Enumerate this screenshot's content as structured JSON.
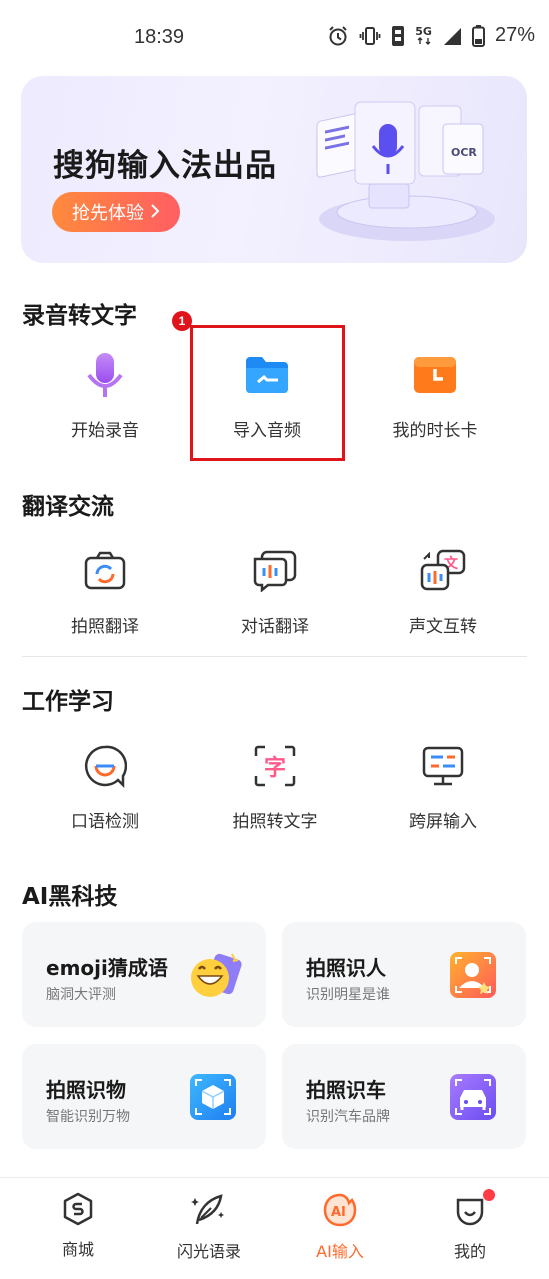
{
  "status_bar": {
    "time": "18:39",
    "network": "5G",
    "battery": "27%",
    "icons": [
      "alarm-icon",
      "vibrate-icon",
      "sim-icon",
      "5g-icon",
      "signal-icon",
      "battery-icon"
    ]
  },
  "banner": {
    "title": "搜狗输入法出品",
    "button_label": "抢先体验",
    "art_tag": "OCR"
  },
  "sections": {
    "record": {
      "title": "录音转文字",
      "items": [
        {
          "label": "开始录音",
          "icon": "microphone-icon"
        },
        {
          "label": "导入音频",
          "icon": "folder-icon"
        },
        {
          "label": "我的时长卡",
          "icon": "clock-card-icon"
        }
      ],
      "badge": "1"
    },
    "translate": {
      "title": "翻译交流",
      "items": [
        {
          "label": "拍照翻译",
          "icon": "camera-translate-icon"
        },
        {
          "label": "对话翻译",
          "icon": "dialog-translate-icon"
        },
        {
          "label": "声文互转",
          "icon": "voice-text-icon"
        }
      ]
    },
    "work": {
      "title": "工作学习",
      "items": [
        {
          "label": "口语检测",
          "icon": "speech-check-icon"
        },
        {
          "label": "拍照转文字",
          "icon": "photo-to-text-icon"
        },
        {
          "label": "跨屏输入",
          "icon": "cross-screen-icon"
        }
      ]
    },
    "ai": {
      "title": "AI黑科技",
      "cards": [
        {
          "title": "emoji猜成语",
          "subtitle": "脑洞大评测",
          "icon": "emoji-icon"
        },
        {
          "title": "拍照识人",
          "subtitle": "识别明星是谁",
          "icon": "face-scan-icon"
        },
        {
          "title": "拍照识物",
          "subtitle": "智能识别万物",
          "icon": "object-scan-icon"
        },
        {
          "title": "拍照识车",
          "subtitle": "识别汽车品牌",
          "icon": "car-scan-icon"
        }
      ]
    }
  },
  "bottom_nav": {
    "items": [
      {
        "label": "商城",
        "icon": "shop-icon"
      },
      {
        "label": "闪光语录",
        "icon": "quill-icon"
      },
      {
        "label": "AI输入",
        "icon": "ai-input-icon",
        "active": true
      },
      {
        "label": "我的",
        "icon": "profile-icon"
      }
    ]
  },
  "colors": {
    "accent": "#ff6a2c",
    "highlight": "#e0151b",
    "card_bg": "#f5f6f8"
  }
}
